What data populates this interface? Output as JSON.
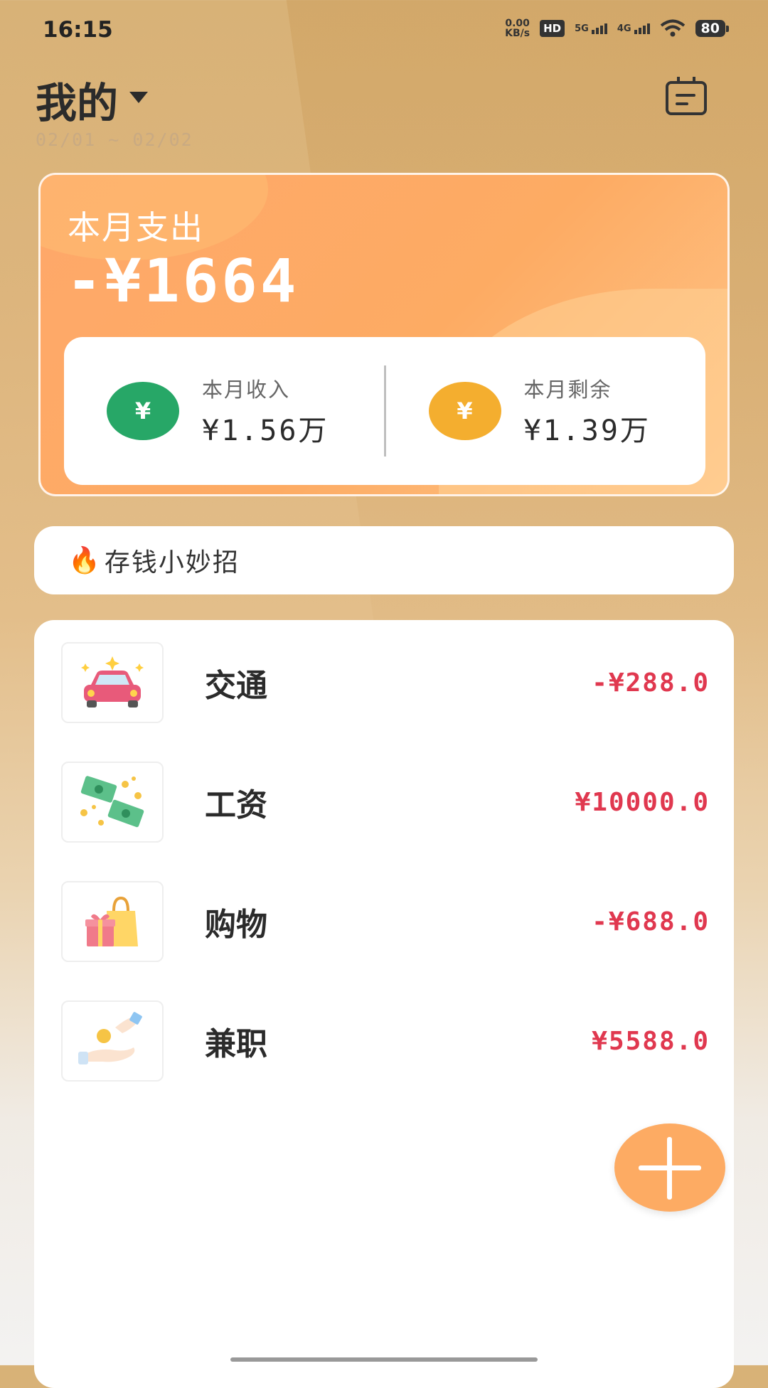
{
  "status_bar": {
    "time": "16:15",
    "net_speed_value": "0.00",
    "net_speed_unit": "KB/s",
    "hd": "HD",
    "sim1": "5G",
    "sim2": "4G",
    "battery": "80"
  },
  "header": {
    "title": "我的",
    "date_range": "02/01 ~ 02/02",
    "calendar_icon": "calendar-icon"
  },
  "summary": {
    "expense_label": "本月支出",
    "expense_amount": "-¥1664",
    "income_label": "本月收入",
    "income_value": "¥1.56万",
    "balance_label": "本月剩余",
    "balance_value": "¥1.39万",
    "income_icon_glyph": "¥",
    "balance_icon_glyph": "¥"
  },
  "tips": {
    "icon": "🔥",
    "text": "存钱小妙招"
  },
  "records": [
    {
      "name": "交通",
      "amount": "-¥288.0",
      "icon": "car-icon"
    },
    {
      "name": "工资",
      "amount": "¥10000.0",
      "icon": "money-icon"
    },
    {
      "name": "购物",
      "amount": "-¥688.0",
      "icon": "shopping-bag-icon"
    },
    {
      "name": "兼职",
      "amount": "¥5588.0",
      "icon": "coin-hand-icon"
    }
  ],
  "colors": {
    "accent": "#fdab63",
    "income_green": "#27a767",
    "balance_yellow": "#f4ae2f",
    "amount_red": "#e0384f"
  }
}
